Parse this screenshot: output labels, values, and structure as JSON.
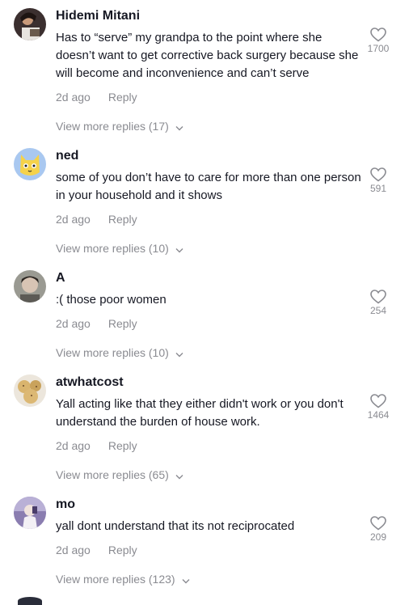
{
  "comments": [
    {
      "username": "Hidemi Mitani",
      "text": "Has to “serve” my grandpa to the point where she doesn’t want to get corrective back surgery because she will become and inconvenience and can’t serve",
      "time": "2d ago",
      "reply_label": "Reply",
      "likes": "1700",
      "view_more": "View more replies (17)"
    },
    {
      "username": "ned",
      "text": "some of you don’t have to care for more than one person in your household and it shows",
      "time": "2d ago",
      "reply_label": "Reply",
      "likes": "591",
      "view_more": "View more replies (10)"
    },
    {
      "username": "A",
      "text": ":( those poor women",
      "time": "2d ago",
      "reply_label": "Reply",
      "likes": "254",
      "view_more": "View more replies (10)"
    },
    {
      "username": "atwhatcost",
      "text": "Yall acting like that they either didn't work or you don't understand the burden of house work.",
      "time": "2d ago",
      "reply_label": "Reply",
      "likes": "1464",
      "view_more": "View more replies (65)"
    },
    {
      "username": "mo",
      "text": "yall dont understand that its not reciprocated",
      "time": "2d ago",
      "reply_label": "Reply",
      "likes": "209",
      "view_more": "View more replies (123)"
    }
  ],
  "colors": {
    "primary_text": "#161823",
    "secondary_text": "#8a8b91",
    "heart_outline": "#8a8b91"
  },
  "icons": {
    "like": "heart-outline-icon",
    "expand": "chevron-down-icon"
  }
}
